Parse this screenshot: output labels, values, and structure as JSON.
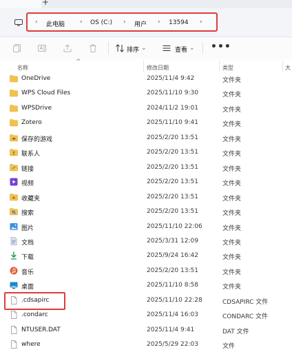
{
  "tabbar": {
    "new_tab": "+"
  },
  "breadcrumb": {
    "items": [
      "此电脑",
      "OS (C:)",
      "用户",
      "13594"
    ]
  },
  "toolbar": {
    "sort_label": "排序",
    "view_label": "查看",
    "more_label": "•••"
  },
  "columns": {
    "name": "名称",
    "date": "修改日期",
    "type": "类型"
  },
  "files": [
    {
      "name": "OneDrive",
      "date": "2025/11/4 9:42",
      "type": "文件夹",
      "icon": "folder-icon"
    },
    {
      "name": "WPS Cloud Files",
      "date": "2025/11/10 9:30",
      "type": "文件夹",
      "icon": "folder-icon"
    },
    {
      "name": "WPSDrive",
      "date": "2024/11/2 19:01",
      "type": "文件夹",
      "icon": "folder-icon"
    },
    {
      "name": "Zotero",
      "date": "2025/11/10 9:41",
      "type": "文件夹",
      "icon": "folder-icon"
    },
    {
      "name": "保存的游戏",
      "date": "2025/2/20 13:51",
      "type": "文件夹",
      "icon": "saved-games-icon"
    },
    {
      "name": "联系人",
      "date": "2025/2/20 13:51",
      "type": "文件夹",
      "icon": "contacts-icon"
    },
    {
      "name": "链接",
      "date": "2025/2/20 13:51",
      "type": "文件夹",
      "icon": "links-icon"
    },
    {
      "name": "视频",
      "date": "2025/2/20 13:51",
      "type": "文件夹",
      "icon": "videos-icon"
    },
    {
      "name": "收藏夹",
      "date": "2025/2/20 13:51",
      "type": "文件夹",
      "icon": "favorites-icon"
    },
    {
      "name": "搜索",
      "date": "2025/2/20 13:51",
      "type": "文件夹",
      "icon": "searches-icon"
    },
    {
      "name": "图片",
      "date": "2025/11/10 22:06",
      "type": "文件夹",
      "icon": "pictures-icon"
    },
    {
      "name": "文档",
      "date": "2025/3/31 12:09",
      "type": "文件夹",
      "icon": "documents-icon"
    },
    {
      "name": "下载",
      "date": "2025/9/24 16:42",
      "type": "文件夹",
      "icon": "downloads-icon"
    },
    {
      "name": "音乐",
      "date": "2025/2/20 13:51",
      "type": "文件夹",
      "icon": "music-icon"
    },
    {
      "name": "桌面",
      "date": "2025/11/10 8:58",
      "type": "文件夹",
      "icon": "desktop-icon"
    },
    {
      "name": ".cdsapirc",
      "date": "2025/11/10 22:28",
      "type": "CDSAPIRC 文件",
      "icon": "file-icon"
    },
    {
      "name": ".condarc",
      "date": "2025/11/4 16:03",
      "type": "CONDARC 文件",
      "icon": "file-icon"
    },
    {
      "name": "NTUSER.DAT",
      "date": "2025/11/4 9:41",
      "type": "DAT 文件",
      "icon": "file-icon"
    },
    {
      "name": "where",
      "date": "2025/5/29 22:03",
      "type": "文件",
      "icon": "file-icon"
    }
  ],
  "colors": {
    "highlight": "#e03a3a",
    "folder": "#f2c34b",
    "folder_dark": "#e0a92c"
  }
}
